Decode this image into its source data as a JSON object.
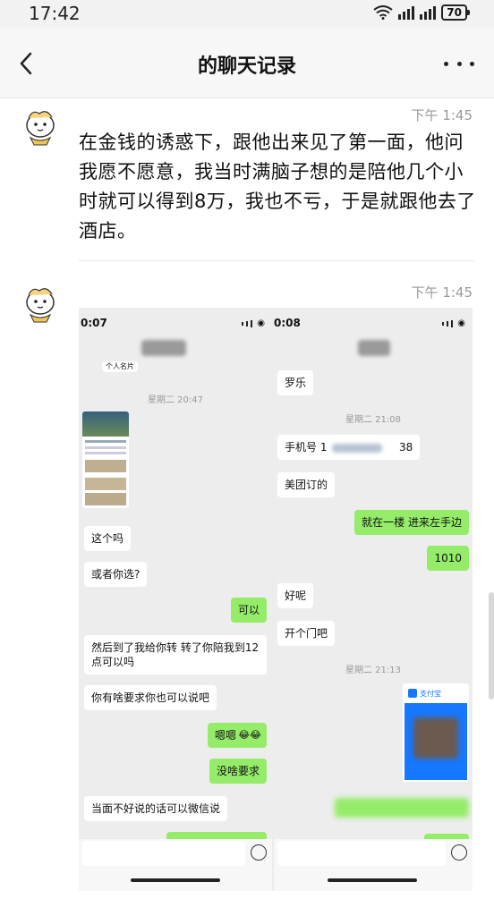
{
  "status_bar": {
    "time": "17:42",
    "battery": "70"
  },
  "header": {
    "title": "的聊天记录"
  },
  "messages": [
    {
      "time": "下午 1:45",
      "text": "在金钱的诱惑下，跟他出来见了第一面，他问我愿不愿意，我当时满脑子想的是陪他几个小时就可以得到8万，我也不亏，于是就跟他去了酒店。"
    },
    {
      "time": "下午 1:45"
    }
  ],
  "screenshot": {
    "left": {
      "time": "0:07",
      "card_label": "个人名片",
      "timestamp": "星期二 20:47",
      "bubbles": [
        {
          "text": "这个吗",
          "side": "in"
        },
        {
          "text": "或者你选?",
          "side": "in"
        },
        {
          "text": "可以",
          "side": "out"
        },
        {
          "text": "然后到了我给你转 转了你陪我到12",
          "text2": "点可以吗",
          "side": "in"
        },
        {
          "text": "你有啥要求你也可以说吧",
          "side": "in"
        },
        {
          "text": "嗯嗯",
          "side": "out"
        },
        {
          "text": "没啥要求",
          "side": "out"
        },
        {
          "text": "当面不好说的话可以微信说",
          "side": "in"
        }
      ]
    },
    "right": {
      "time": "0:08",
      "timestamp1": "星期二 21:08",
      "timestamp2": "星期二 21:13",
      "alipay_label": "支付宝",
      "bubbles": [
        {
          "text": "罗乐",
          "side": "in"
        },
        {
          "text": "手机号 1",
          "tail": "38",
          "side": "in"
        },
        {
          "text": "美团订的",
          "side": "in"
        },
        {
          "text": "就在一楼 进来左手边",
          "side": "out"
        },
        {
          "text": "1010",
          "side": "out"
        },
        {
          "text": "好呢",
          "side": "in"
        },
        {
          "text": "开个门吧",
          "side": "in"
        }
      ]
    }
  },
  "colors": {
    "bubble_out": "#95ec69",
    "bubble_in": "#ffffff",
    "chat_bg": "#ededed"
  }
}
